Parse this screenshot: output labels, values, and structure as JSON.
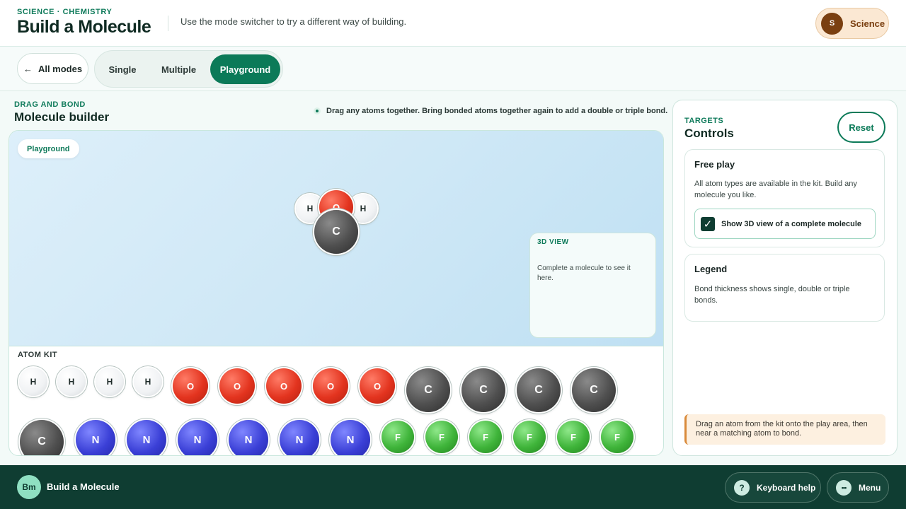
{
  "header": {
    "breadcrumb": "SCIENCE · CHEMISTRY",
    "title": "Build a Molecule",
    "subtitle": "Use the mode switcher to try a different way of building.",
    "subject_avatar": "S",
    "subject_label": "Science"
  },
  "modebar": {
    "back_icon": "←",
    "back_label": "All modes",
    "tabs": [
      {
        "label": "Single",
        "active": false
      },
      {
        "label": "Multiple",
        "active": false
      },
      {
        "label": "Playground",
        "active": true
      }
    ]
  },
  "builder": {
    "kicker": "DRAG AND BOND",
    "title": "Molecule builder",
    "hint": "Drag any atoms together. Bring bonded atoms together again to add a double or triple bond.",
    "mode_badge": "Playground",
    "molecule_atoms": [
      {
        "symbol": "H",
        "element": "h"
      },
      {
        "symbol": "H",
        "element": "h"
      },
      {
        "symbol": "O",
        "element": "o"
      },
      {
        "symbol": "C",
        "element": "c"
      }
    ],
    "view3d": {
      "title": "3D VIEW",
      "text": "Complete a molecule to see it here."
    },
    "kit_label": "ATOM KIT",
    "kit_row1": [
      {
        "symbol": "H",
        "element": "h"
      },
      {
        "symbol": "H",
        "element": "h"
      },
      {
        "symbol": "H",
        "element": "h"
      },
      {
        "symbol": "H",
        "element": "h"
      },
      {
        "symbol": "O",
        "element": "o"
      },
      {
        "symbol": "O",
        "element": "o"
      },
      {
        "symbol": "O",
        "element": "o"
      },
      {
        "symbol": "O",
        "element": "o"
      },
      {
        "symbol": "O",
        "element": "o"
      },
      {
        "symbol": "C",
        "element": "c"
      },
      {
        "symbol": "C",
        "element": "c"
      },
      {
        "symbol": "C",
        "element": "c"
      },
      {
        "symbol": "C",
        "element": "c"
      }
    ],
    "kit_row2": [
      {
        "symbol": "C",
        "element": "c"
      },
      {
        "symbol": "N",
        "element": "n"
      },
      {
        "symbol": "N",
        "element": "n"
      },
      {
        "symbol": "N",
        "element": "n"
      },
      {
        "symbol": "N",
        "element": "n"
      },
      {
        "symbol": "N",
        "element": "n"
      },
      {
        "symbol": "N",
        "element": "n"
      },
      {
        "symbol": "F",
        "element": "f"
      },
      {
        "symbol": "F",
        "element": "f"
      },
      {
        "symbol": "F",
        "element": "f"
      },
      {
        "symbol": "F",
        "element": "f"
      },
      {
        "symbol": "F",
        "element": "f"
      },
      {
        "symbol": "F",
        "element": "f"
      }
    ]
  },
  "controls": {
    "kicker": "TARGETS",
    "title": "Controls",
    "reset_label": "Reset",
    "free_play": {
      "title": "Free play",
      "text": "All atom types are available in the kit. Build any molecule you like.",
      "checkbox_label": "Show 3D view of a complete molecule",
      "checked": true,
      "check_glyph": "✓"
    },
    "legend": {
      "title": "Legend",
      "text": "Bond thickness shows single, double or triple bonds."
    },
    "note": "Drag an atom from the kit onto the play area, then near a matching atom to bond."
  },
  "footer": {
    "logo": "Bm",
    "name": "Build a Molecule",
    "help_icon": "?",
    "help_label": "Keyboard help",
    "menu_icon": "•••",
    "menu_label": "Menu"
  },
  "colors": {
    "accent": "#0b7a58",
    "footer": "#0f3d32",
    "hydrogen": "#f0f2f4",
    "oxygen": "#e3341f",
    "carbon": "#4f4f4f",
    "nitrogen": "#3a3fd6",
    "fluorine": "#3fb43a"
  }
}
